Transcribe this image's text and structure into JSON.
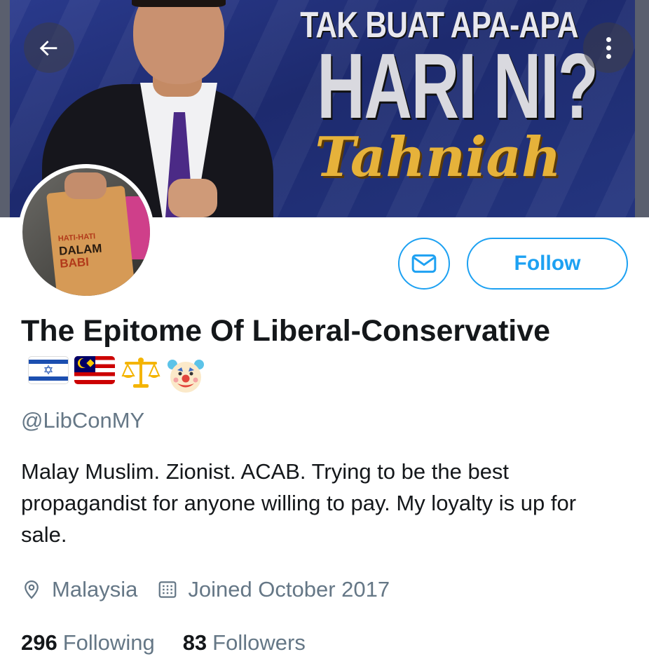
{
  "banner": {
    "line1": "TAK BUAT APA-APA",
    "line2": "HARI NI?",
    "line3": "Tahniah"
  },
  "avatar": {
    "bag_line1": "HATI-HATI",
    "bag_line2": "DALAM",
    "bag_line3": "BABI"
  },
  "actions": {
    "follow_label": "Follow"
  },
  "profile": {
    "name": "The Epitome Of Liberal-Conservative",
    "name_emojis": [
      "israel-flag-icon",
      "malaysia-flag-icon",
      "scales-icon",
      "clown-face-icon"
    ],
    "handle": "@LibConMY",
    "bio": "Malay Muslim. Zionist. ACAB. Trying to be the best propagandist for anyone willing to pay. My loyalty is up for sale.",
    "location": "Malaysia",
    "joined": "Joined October 2017"
  },
  "stats": {
    "following_count": "296",
    "following_label": "Following",
    "followers_count": "83",
    "followers_label": "Followers"
  },
  "colors": {
    "accent": "#1da1f2",
    "secondary_text": "#657786",
    "primary_text": "#14171a"
  }
}
